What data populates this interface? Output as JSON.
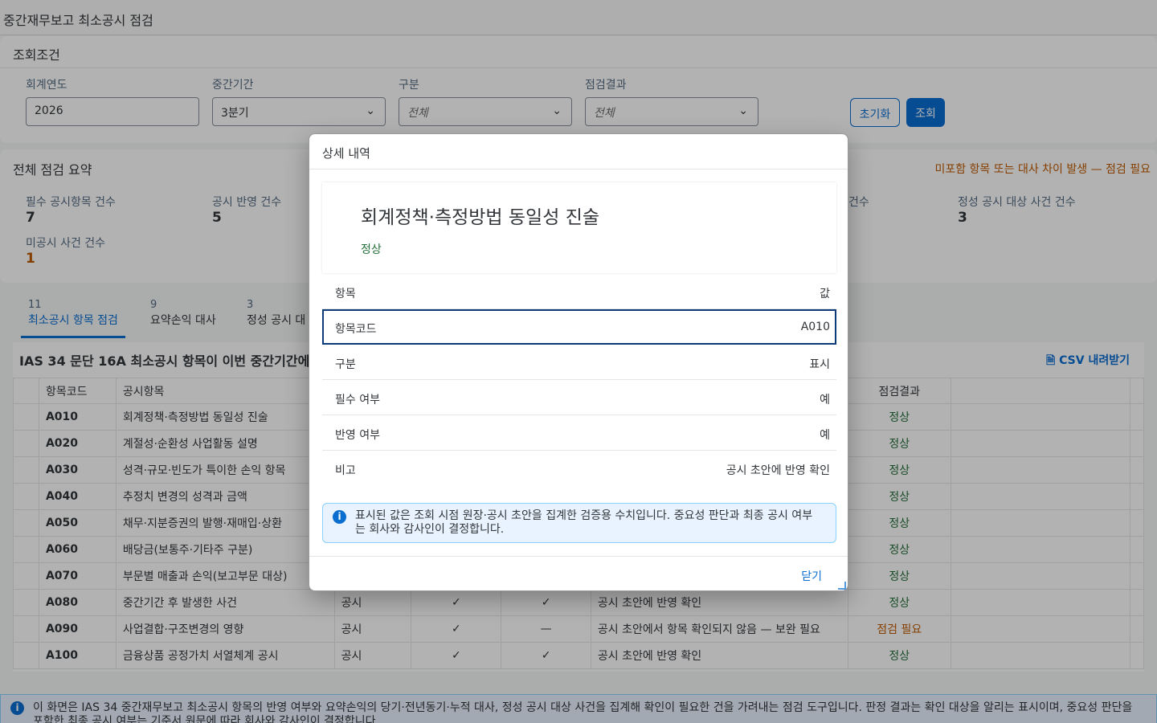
{
  "page_title": "중간재무보고 최소공시 점검",
  "filters": {
    "header": "조회조건",
    "fiscal_year": {
      "label": "회계연도",
      "value": "2026"
    },
    "period": {
      "label": "중간기간",
      "value": "3분기"
    },
    "category": {
      "label": "구분",
      "placeholder": "전체"
    },
    "result": {
      "label": "점검결과",
      "placeholder": "전체"
    },
    "reset_label": "초기화",
    "search_label": "조회"
  },
  "summary": {
    "title": "전체 점검 요약",
    "warning": "미포함 항목 또는 대사 차이 발생 — 점검 필요",
    "kpis": [
      {
        "label": "필수 공시항목 건수",
        "value": "7"
      },
      {
        "label": "공시 반영 건수",
        "value": "5"
      },
      {
        "label": "건수",
        "value": ""
      },
      {
        "label": "정성 공시 대상 사건 건수",
        "value": "3"
      },
      {
        "label": "미공시 사건 건수",
        "value": "1"
      }
    ]
  },
  "tabs": [
    {
      "count": "11",
      "label": "최소공시 항목 점검"
    },
    {
      "count": "9",
      "label": "요약손익 대사"
    },
    {
      "count": "3",
      "label": "정성 공시 대"
    }
  ],
  "table": {
    "caption": "IAS 34 문단 16A 최소공시 항목이 이번 중간기간에",
    "csv_label": "CSV 내려받기",
    "headers": [
      "항목코드",
      "공시항목",
      "",
      "",
      "",
      "",
      "점검결과"
    ],
    "rows": [
      {
        "code": "A010",
        "item": "회계정책·측정방법 동일성 진술",
        "type": "",
        "req": "",
        "ref": "",
        "note": "",
        "result": "정상"
      },
      {
        "code": "A020",
        "item": "계절성·순환성 사업활동 설명",
        "type": "",
        "req": "",
        "ref": "",
        "note": "",
        "result": "정상"
      },
      {
        "code": "A030",
        "item": "성격·규모·빈도가 특이한 손익 항목",
        "type": "",
        "req": "",
        "ref": "",
        "note": "",
        "result": "정상"
      },
      {
        "code": "A040",
        "item": "추정치 변경의 성격과 금액",
        "type": "",
        "req": "",
        "ref": "",
        "note": "",
        "result": "정상"
      },
      {
        "code": "A050",
        "item": "채무·지분증권의 발행·재매입·상환",
        "type": "",
        "req": "",
        "ref": "",
        "note": "",
        "result": "정상"
      },
      {
        "code": "A060",
        "item": "배당금(보통주·기타주 구분)",
        "type": "",
        "req": "",
        "ref": "",
        "note": "",
        "result": "정상"
      },
      {
        "code": "A070",
        "item": "부문별 매출과 손익(보고부문 대상)",
        "type": "",
        "req": "",
        "ref": "",
        "note": "",
        "result": "정상"
      },
      {
        "code": "A080",
        "item": "중간기간 후 발생한 사건",
        "type": "공시",
        "req": "✓",
        "ref": "✓",
        "note": "공시 초안에 반영 확인",
        "result": "정상"
      },
      {
        "code": "A090",
        "item": "사업결합·구조변경의 영향",
        "type": "공시",
        "req": "✓",
        "ref": "—",
        "note": "공시 초안에서 항목 확인되지 않음 — 보완 필요",
        "result": "점검 필요"
      },
      {
        "code": "A100",
        "item": "금융상품 공정가치 서열체계 공시",
        "type": "공시",
        "req": "✓",
        "ref": "✓",
        "note": "공시 초안에 반영 확인",
        "result": "정상"
      }
    ]
  },
  "info_strip": "이 화면은 IAS 34 중간재무보고 최소공시 항목의 반영 여부와 요약손익의 당기·전년동기·누적 대사, 정성 공시 대상 사건을 집계해 확인이 필요한 건을 가려내는 점검 도구입니다. 판정 결과는 확인 대상을 알리는 표시이며, 중요성 판단을 포함한 최종 공시 여부는 기준서 원문에 따라 회사와 감사인이 결정합니다.",
  "dialog": {
    "title": "상세 내역",
    "detail_title": "회계정책·측정방법 동일성 진술",
    "detail_status": "정상",
    "rows": [
      {
        "k": "항목",
        "v": "값"
      },
      {
        "k": "항목코드",
        "v": "A010"
      },
      {
        "k": "구분",
        "v": "표시"
      },
      {
        "k": "필수 여부",
        "v": "예"
      },
      {
        "k": "반영 여부",
        "v": "예"
      },
      {
        "k": "비고",
        "v": "공시 초안에 반영 확인"
      }
    ],
    "info": "표시된 값은 조회 시점 원장·공시 초안을 집계한 검증용 수치입니다. 중요성 판단과 최종 공시 여부는 회사와 감사인이 결정합니다.",
    "close_label": "닫기"
  },
  "colors": {
    "accent": "#0a6ed1",
    "ok": "#256f3a",
    "warn": "#c05a00"
  }
}
